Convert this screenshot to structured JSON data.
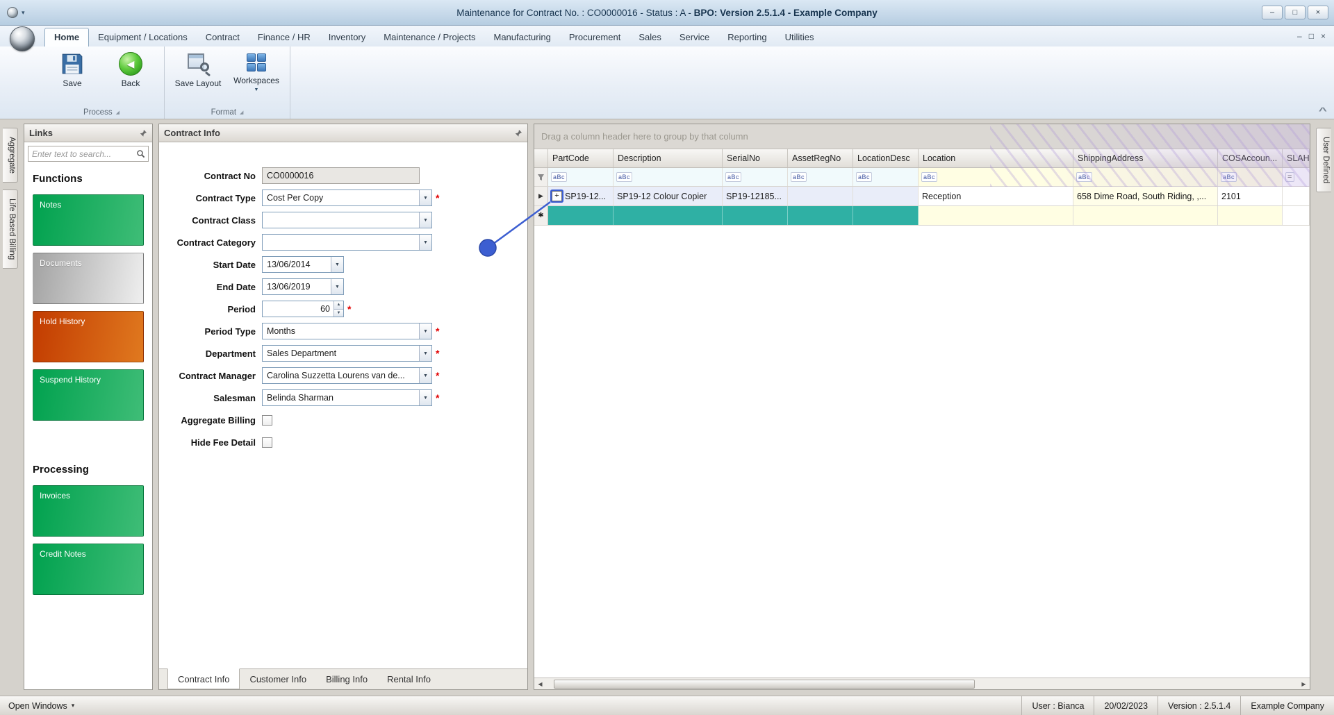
{
  "window": {
    "title_prefix": "Maintenance for Contract No. : CO0000016 - Status : A - ",
    "title_bold": "BPO: Version 2.5.1.4 - Example Company"
  },
  "icons": {
    "minimize": "–",
    "restore": "□",
    "close": "×",
    "dropdown": "▼",
    "caret": "▾",
    "spin_up": "▲",
    "spin_down": "▼",
    "row_current": "▶",
    "row_new": "✱",
    "filter_contains": "aBc",
    "filter_equals": "=",
    "expand": "+",
    "scroll_left": "◀",
    "scroll_right": "▶",
    "launcher": "◢",
    "collapse": "^",
    "required": "*"
  },
  "ribbon": {
    "tabs": [
      "Home",
      "Equipment / Locations",
      "Contract",
      "Finance / HR",
      "Inventory",
      "Maintenance / Projects",
      "Manufacturing",
      "Procurement",
      "Sales",
      "Service",
      "Reporting",
      "Utilities"
    ],
    "buttons": {
      "save": "Save",
      "back": "Back",
      "save_layout": "Save Layout",
      "workspaces": "Workspaces"
    },
    "groups": {
      "process": "Process",
      "format": "Format"
    }
  },
  "side_tabs": {
    "left": [
      "Aggregate",
      "Life Based Billing"
    ],
    "right": [
      "User Defined"
    ]
  },
  "links": {
    "title": "Links",
    "search_placeholder": "Enter text to search...",
    "functions_title": "Functions",
    "processing_title": "Processing",
    "functions": [
      "Notes",
      "Documents",
      "Hold History",
      "Suspend History"
    ],
    "processing": [
      "Invoices",
      "Credit Notes"
    ]
  },
  "contract": {
    "title": "Contract Info",
    "fields": {
      "contract_no": {
        "label": "Contract No",
        "value": "CO0000016"
      },
      "contract_type": {
        "label": "Contract Type",
        "value": "Cost Per Copy"
      },
      "contract_class": {
        "label": "Contract Class",
        "value": ""
      },
      "contract_category": {
        "label": "Contract Category",
        "value": ""
      },
      "start_date": {
        "label": "Start Date",
        "value": "13/06/2014"
      },
      "end_date": {
        "label": "End Date",
        "value": "13/06/2019"
      },
      "period": {
        "label": "Period",
        "value": "60"
      },
      "period_type": {
        "label": "Period Type",
        "value": "Months"
      },
      "department": {
        "label": "Department",
        "value": "Sales Department"
      },
      "contract_manager": {
        "label": "Contract Manager",
        "value": "Carolina Suzzetta Lourens van de..."
      },
      "salesman": {
        "label": "Salesman",
        "value": "Belinda Sharman"
      },
      "aggregate_billing": {
        "label": "Aggregate Billing"
      },
      "hide_fee_detail": {
        "label": "Hide Fee Detail"
      }
    },
    "tabs": [
      "Contract Info",
      "Customer Info",
      "Billing Info",
      "Rental Info"
    ]
  },
  "grid": {
    "group_hint": "Drag a column header here to group by that column",
    "columns": [
      "PartCode",
      "Description",
      "SerialNo",
      "AssetRegNo",
      "LocationDesc",
      "Location",
      "ShippingAddress",
      "COSAccoun...",
      "SLAHou..."
    ],
    "row": {
      "part_code": "SP19-12...",
      "description": "SP19-12 Colour Copier",
      "serial_no": "SP19-12185...",
      "asset_reg_no": "",
      "location_desc": "",
      "location": "Reception",
      "shipping_address": "658 Dime Road, South Riding, ,...",
      "cos_account": "2101",
      "sla_hour": ""
    }
  },
  "status": {
    "open_windows": "Open Windows",
    "user": "User : Bianca",
    "date": "20/02/2023",
    "version": "Version : 2.5.1.4",
    "company": "Example Company"
  },
  "colors": {
    "annotation_blue": "#3c5ed1",
    "new_row_teal": "#2fb0a4",
    "link_green": "#00a14e",
    "link_orange": "#c23b00"
  }
}
